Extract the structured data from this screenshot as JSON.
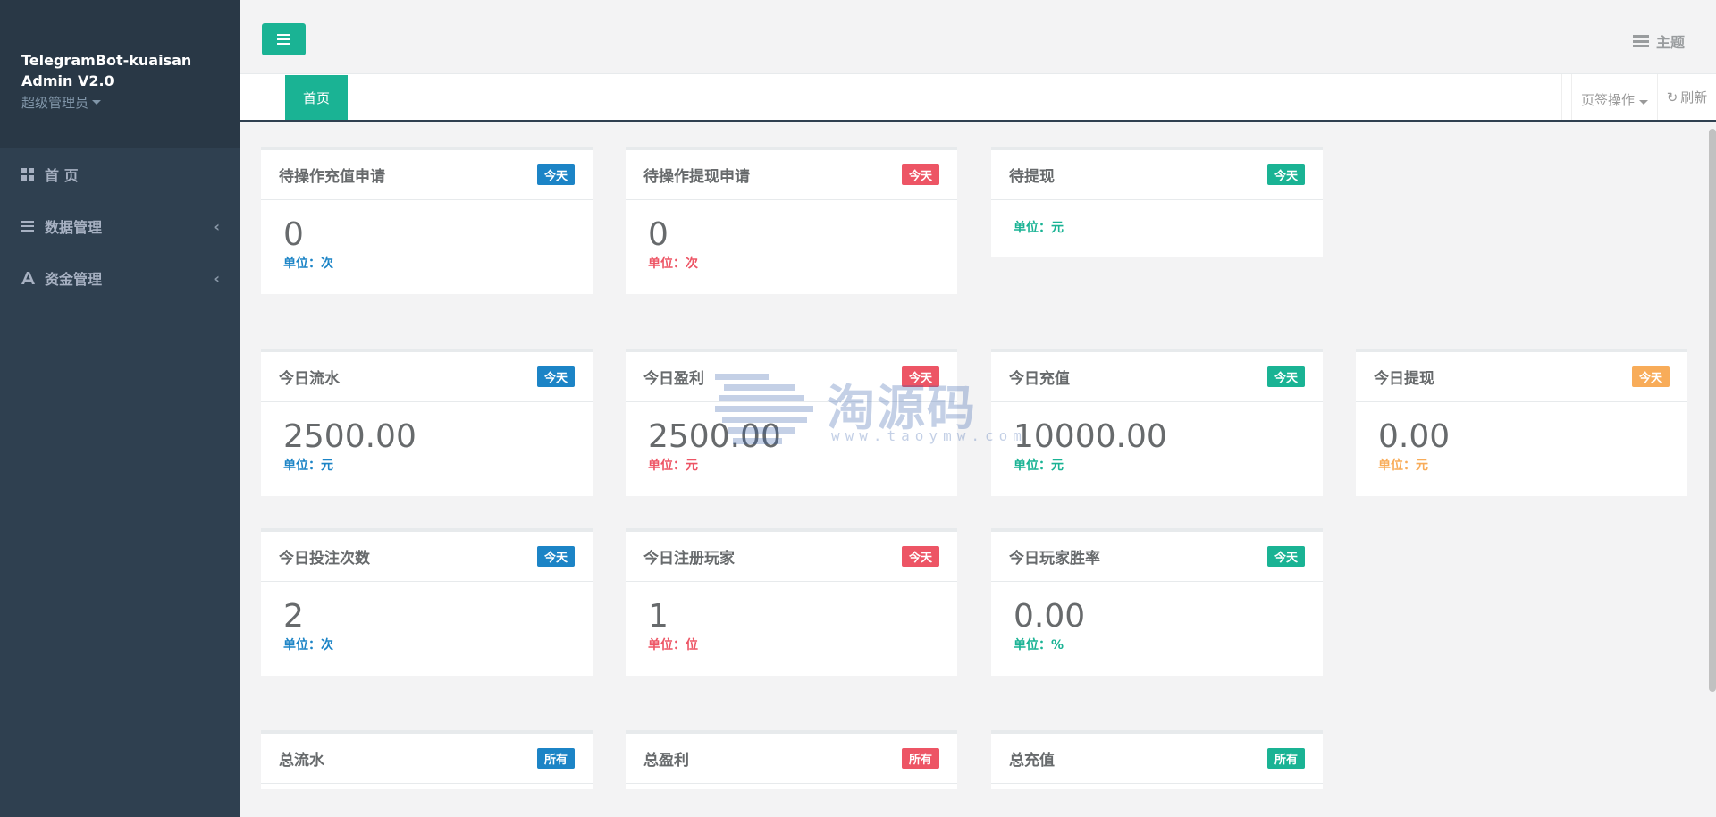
{
  "sidebar": {
    "app_title": "TelegramBot-kuaisan\nAdmin V2.0",
    "user_role": "超级管理员",
    "items": [
      {
        "label": "首 页",
        "icon": "grid-icon"
      },
      {
        "label": "数据管理",
        "icon": "list-icon",
        "expandable": true
      },
      {
        "label": "资金管理",
        "icon": "font-icon",
        "expandable": true
      }
    ]
  },
  "topbar": {
    "theme_label": "主题"
  },
  "tabs": {
    "home_label": "首页",
    "actions_label": "页签操作",
    "refresh_label": "刷新"
  },
  "panels": {
    "p1": {
      "title": "待操作充值申请",
      "badge": "今天",
      "value": "0",
      "unit": "单位：次"
    },
    "p2": {
      "title": "待操作提现申请",
      "badge": "今天",
      "value": "0",
      "unit": "单位：次"
    },
    "p3": {
      "title": "待提现",
      "badge": "今天",
      "value": "",
      "unit": "单位：元"
    },
    "p4": {
      "title": "今日流水",
      "badge": "今天",
      "value": "2500.00",
      "unit": "单位：元"
    },
    "p5": {
      "title": "今日盈利",
      "badge": "今天",
      "value": "2500.00",
      "unit": "单位：元"
    },
    "p6": {
      "title": "今日充值",
      "badge": "今天",
      "value": "10000.00",
      "unit": "单位：元"
    },
    "p7": {
      "title": "今日提现",
      "badge": "今天",
      "value": "0.00",
      "unit": "单位：元"
    },
    "p8": {
      "title": "今日投注次数",
      "badge": "今天",
      "value": "2",
      "unit": "单位：次"
    },
    "p9": {
      "title": "今日注册玩家",
      "badge": "今天",
      "value": "1",
      "unit": "单位：位"
    },
    "p10": {
      "title": "今日玩家胜率",
      "badge": "今天",
      "value": "0.00",
      "unit": "单位：%"
    },
    "p11": {
      "title": "总流水",
      "badge": "所有"
    },
    "p12": {
      "title": "总盈利",
      "badge": "所有"
    },
    "p13": {
      "title": "总充值",
      "badge": "所有"
    }
  },
  "watermark": {
    "text": "淘源码",
    "url": "www.taoymw.com"
  },
  "colors": {
    "accent": "#1ab394",
    "sidebar": "#2f4050",
    "blue": "#1c84c6",
    "red": "#ed5565",
    "orange": "#f8ac59"
  }
}
